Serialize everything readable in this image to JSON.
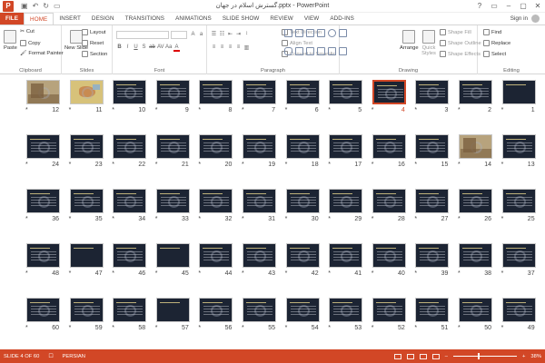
{
  "app": {
    "title": "گسترش اسلام در جهان.pptx - PowerPoint",
    "logo": "P"
  },
  "window_controls": [
    "?",
    "▭",
    "–",
    "▢",
    "✕"
  ],
  "tabs": [
    {
      "label": "FILE",
      "kind": "file"
    },
    {
      "label": "HOME",
      "kind": "active"
    },
    {
      "label": "INSERT",
      "kind": ""
    },
    {
      "label": "DESIGN",
      "kind": ""
    },
    {
      "label": "TRANSITIONS",
      "kind": ""
    },
    {
      "label": "ANIMATIONS",
      "kind": ""
    },
    {
      "label": "SLIDE SHOW",
      "kind": ""
    },
    {
      "label": "REVIEW",
      "kind": ""
    },
    {
      "label": "VIEW",
      "kind": ""
    },
    {
      "label": "ADD-INS",
      "kind": ""
    }
  ],
  "sign_in": "Sign in",
  "ribbon": {
    "clipboard": {
      "label": "Clipboard",
      "paste": "Paste",
      "cut": "Cut",
      "copy": "Copy",
      "format_painter": "Format Painter"
    },
    "slides": {
      "label": "Slides",
      "new_slide": "New Slide",
      "layout": "Layout",
      "reset": "Reset",
      "section": "Section"
    },
    "font": {
      "label": "Font"
    },
    "paragraph": {
      "label": "Paragraph",
      "text_direction": "Text Direction",
      "align_text": "Align Text",
      "convert_smartart": "Convert to SmartArt"
    },
    "drawing": {
      "label": "Drawing",
      "arrange": "Arrange",
      "quick_styles": "Quick Styles",
      "shape_fill": "Shape Fill",
      "shape_outline": "Shape Outline",
      "shape_effects": "Shape Effects"
    },
    "editing": {
      "label": "Editing",
      "find": "Find",
      "replace": "Replace",
      "select": "Select"
    }
  },
  "slides": [
    {
      "n": 1,
      "row": 0,
      "col": 11,
      "kind": "title"
    },
    {
      "n": 2,
      "row": 0,
      "col": 10,
      "kind": "text"
    },
    {
      "n": 3,
      "row": 0,
      "col": 9,
      "kind": "text"
    },
    {
      "n": 4,
      "row": 0,
      "col": 8,
      "kind": "text",
      "selected": true
    },
    {
      "n": 5,
      "row": 0,
      "col": 7,
      "kind": "text"
    },
    {
      "n": 6,
      "row": 0,
      "col": 6,
      "kind": "text"
    },
    {
      "n": 7,
      "row": 0,
      "col": 5,
      "kind": "text"
    },
    {
      "n": 8,
      "row": 0,
      "col": 4,
      "kind": "text"
    },
    {
      "n": 9,
      "row": 0,
      "col": 3,
      "kind": "text"
    },
    {
      "n": 10,
      "row": 0,
      "col": 2,
      "kind": "text"
    },
    {
      "n": 11,
      "row": 0,
      "col": 1,
      "kind": "map"
    },
    {
      "n": 12,
      "row": 0,
      "col": 0,
      "kind": "photo"
    },
    {
      "n": 13,
      "row": 1,
      "col": 11,
      "kind": "text"
    },
    {
      "n": 14,
      "row": 1,
      "col": 10,
      "kind": "photo"
    },
    {
      "n": 15,
      "row": 1,
      "col": 9,
      "kind": "text"
    },
    {
      "n": 16,
      "row": 1,
      "col": 8,
      "kind": "text"
    },
    {
      "n": 17,
      "row": 1,
      "col": 7,
      "kind": "text"
    },
    {
      "n": 18,
      "row": 1,
      "col": 6,
      "kind": "text"
    },
    {
      "n": 19,
      "row": 1,
      "col": 5,
      "kind": "text"
    },
    {
      "n": 20,
      "row": 1,
      "col": 4,
      "kind": "text"
    },
    {
      "n": 21,
      "row": 1,
      "col": 3,
      "kind": "text"
    },
    {
      "n": 22,
      "row": 1,
      "col": 2,
      "kind": "text"
    },
    {
      "n": 23,
      "row": 1,
      "col": 1,
      "kind": "text"
    },
    {
      "n": 24,
      "row": 1,
      "col": 0,
      "kind": "text"
    },
    {
      "n": 25,
      "row": 2,
      "col": 11,
      "kind": "text"
    },
    {
      "n": 26,
      "row": 2,
      "col": 10,
      "kind": "text"
    },
    {
      "n": 27,
      "row": 2,
      "col": 9,
      "kind": "text"
    },
    {
      "n": 28,
      "row": 2,
      "col": 8,
      "kind": "text"
    },
    {
      "n": 29,
      "row": 2,
      "col": 7,
      "kind": "text"
    },
    {
      "n": 30,
      "row": 2,
      "col": 6,
      "kind": "text"
    },
    {
      "n": 31,
      "row": 2,
      "col": 5,
      "kind": "text"
    },
    {
      "n": 32,
      "row": 2,
      "col": 4,
      "kind": "text"
    },
    {
      "n": 33,
      "row": 2,
      "col": 3,
      "kind": "text"
    },
    {
      "n": 34,
      "row": 2,
      "col": 2,
      "kind": "text"
    },
    {
      "n": 35,
      "row": 2,
      "col": 1,
      "kind": "text"
    },
    {
      "n": 36,
      "row": 2,
      "col": 0,
      "kind": "text"
    },
    {
      "n": 37,
      "row": 3,
      "col": 11,
      "kind": "text"
    },
    {
      "n": 38,
      "row": 3,
      "col": 10,
      "kind": "text"
    },
    {
      "n": 39,
      "row": 3,
      "col": 9,
      "kind": "text"
    },
    {
      "n": 40,
      "row": 3,
      "col": 8,
      "kind": "text"
    },
    {
      "n": 41,
      "row": 3,
      "col": 7,
      "kind": "text"
    },
    {
      "n": 42,
      "row": 3,
      "col": 6,
      "kind": "text"
    },
    {
      "n": 43,
      "row": 3,
      "col": 5,
      "kind": "text"
    },
    {
      "n": 44,
      "row": 3,
      "col": 4,
      "kind": "text"
    },
    {
      "n": 45,
      "row": 3,
      "col": 3,
      "kind": "title"
    },
    {
      "n": 46,
      "row": 3,
      "col": 2,
      "kind": "text"
    },
    {
      "n": 47,
      "row": 3,
      "col": 1,
      "kind": "title"
    },
    {
      "n": 48,
      "row": 3,
      "col": 0,
      "kind": "text"
    },
    {
      "n": 49,
      "row": 4,
      "col": 11,
      "kind": "text"
    },
    {
      "n": 50,
      "row": 4,
      "col": 10,
      "kind": "text"
    },
    {
      "n": 51,
      "row": 4,
      "col": 9,
      "kind": "text"
    },
    {
      "n": 52,
      "row": 4,
      "col": 8,
      "kind": "text"
    },
    {
      "n": 53,
      "row": 4,
      "col": 7,
      "kind": "text"
    },
    {
      "n": 54,
      "row": 4,
      "col": 6,
      "kind": "text"
    },
    {
      "n": 55,
      "row": 4,
      "col": 5,
      "kind": "text"
    },
    {
      "n": 56,
      "row": 4,
      "col": 4,
      "kind": "text"
    },
    {
      "n": 57,
      "row": 4,
      "col": 3,
      "kind": "title"
    },
    {
      "n": 58,
      "row": 4,
      "col": 2,
      "kind": "text"
    },
    {
      "n": 59,
      "row": 4,
      "col": 1,
      "kind": "text"
    },
    {
      "n": 60,
      "row": 4,
      "col": 0,
      "kind": "text"
    }
  ],
  "star_glyph": "*",
  "status": {
    "slide_info": "SLIDE 4 OF 60",
    "language": "PERSIAN",
    "zoom": "38%",
    "zoom_fraction": 0.38
  },
  "colors": {
    "accent": "#d24726",
    "slide_bg": "#1c2433"
  }
}
